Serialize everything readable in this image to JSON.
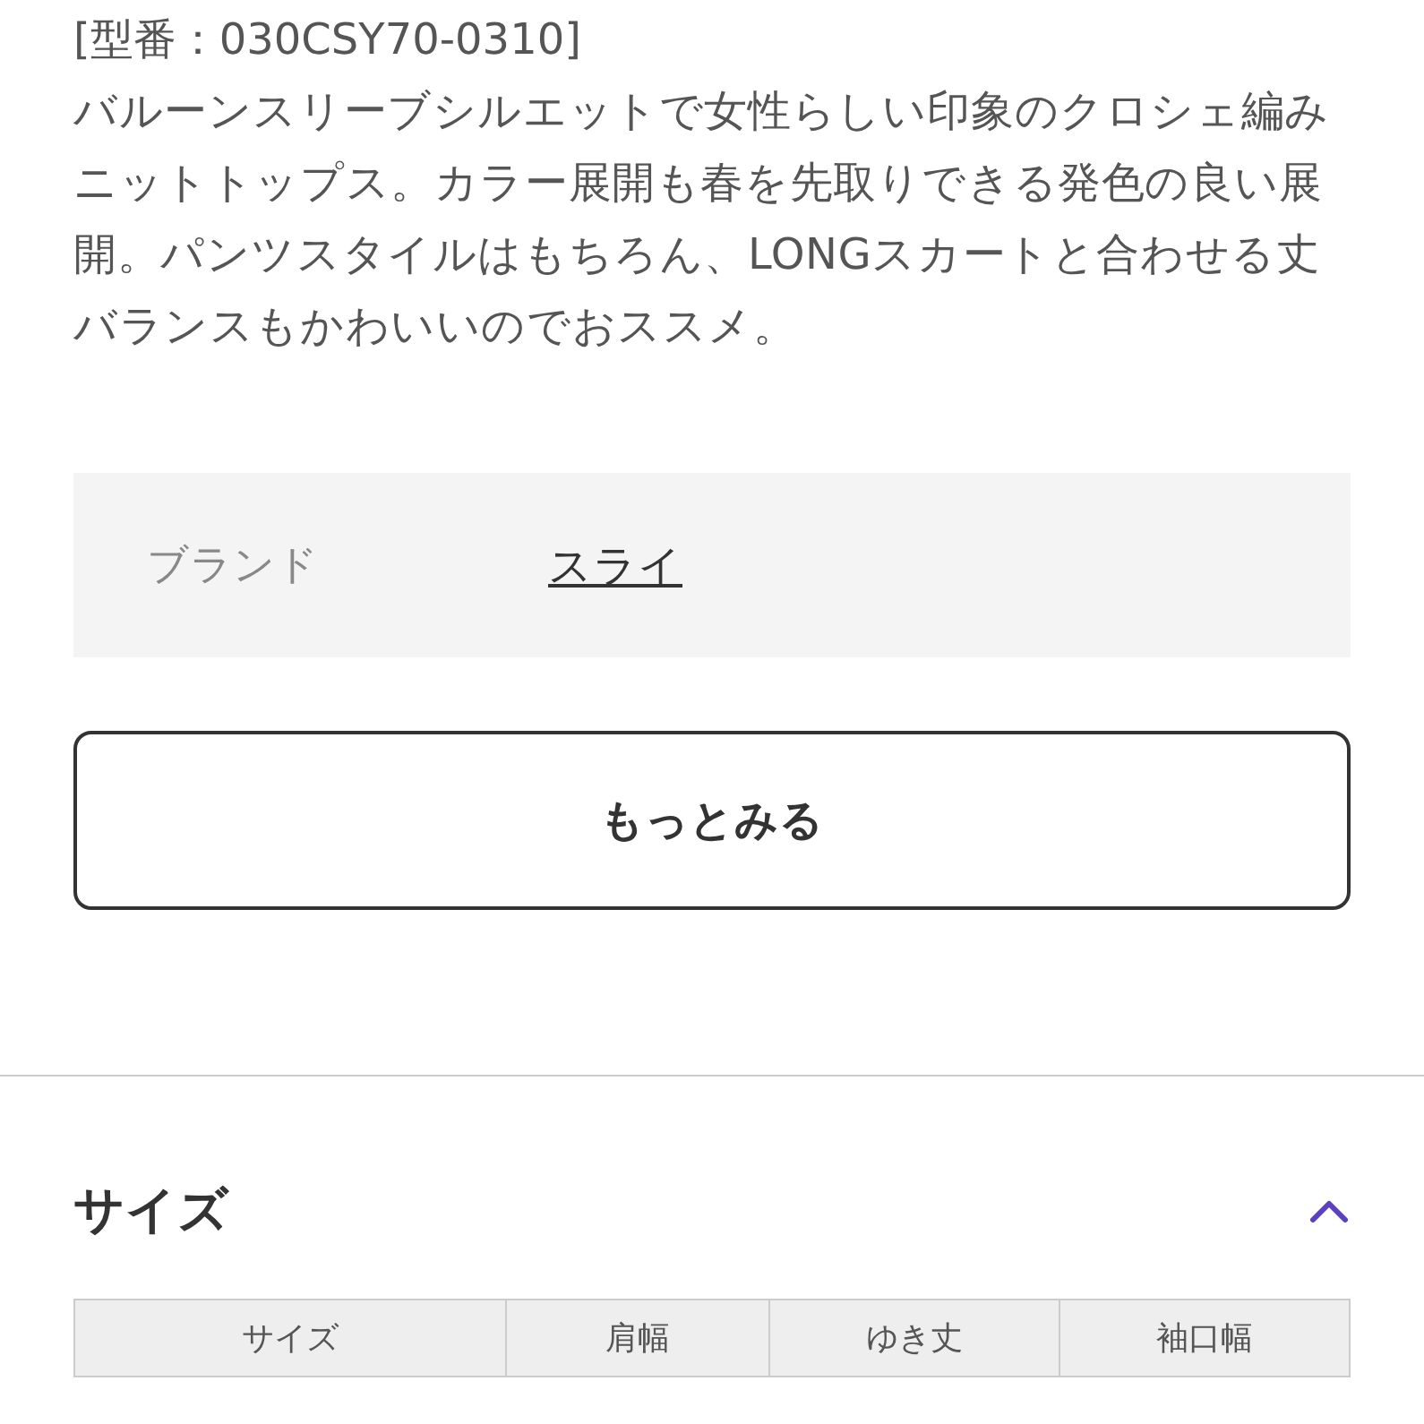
{
  "model_number": "[型番：030CSY70-0310]",
  "description": "バルーンスリーブシルエットで女性らしい印象のクロシェ編みニットトップス。カラー展開も春を先取りできる発色の良い展開。パンツスタイルはもちろん、LONGスカートと合わせる丈バランスもかわいいのでおススメ。",
  "brand": {
    "label": "ブランド",
    "value": "スライ"
  },
  "more_button": "もっとみる",
  "size_section": {
    "title": "サイズ",
    "expanded": true,
    "table": {
      "columns": [
        "サイズ",
        "肩幅",
        "ゆき丈",
        "袖口幅"
      ]
    }
  }
}
